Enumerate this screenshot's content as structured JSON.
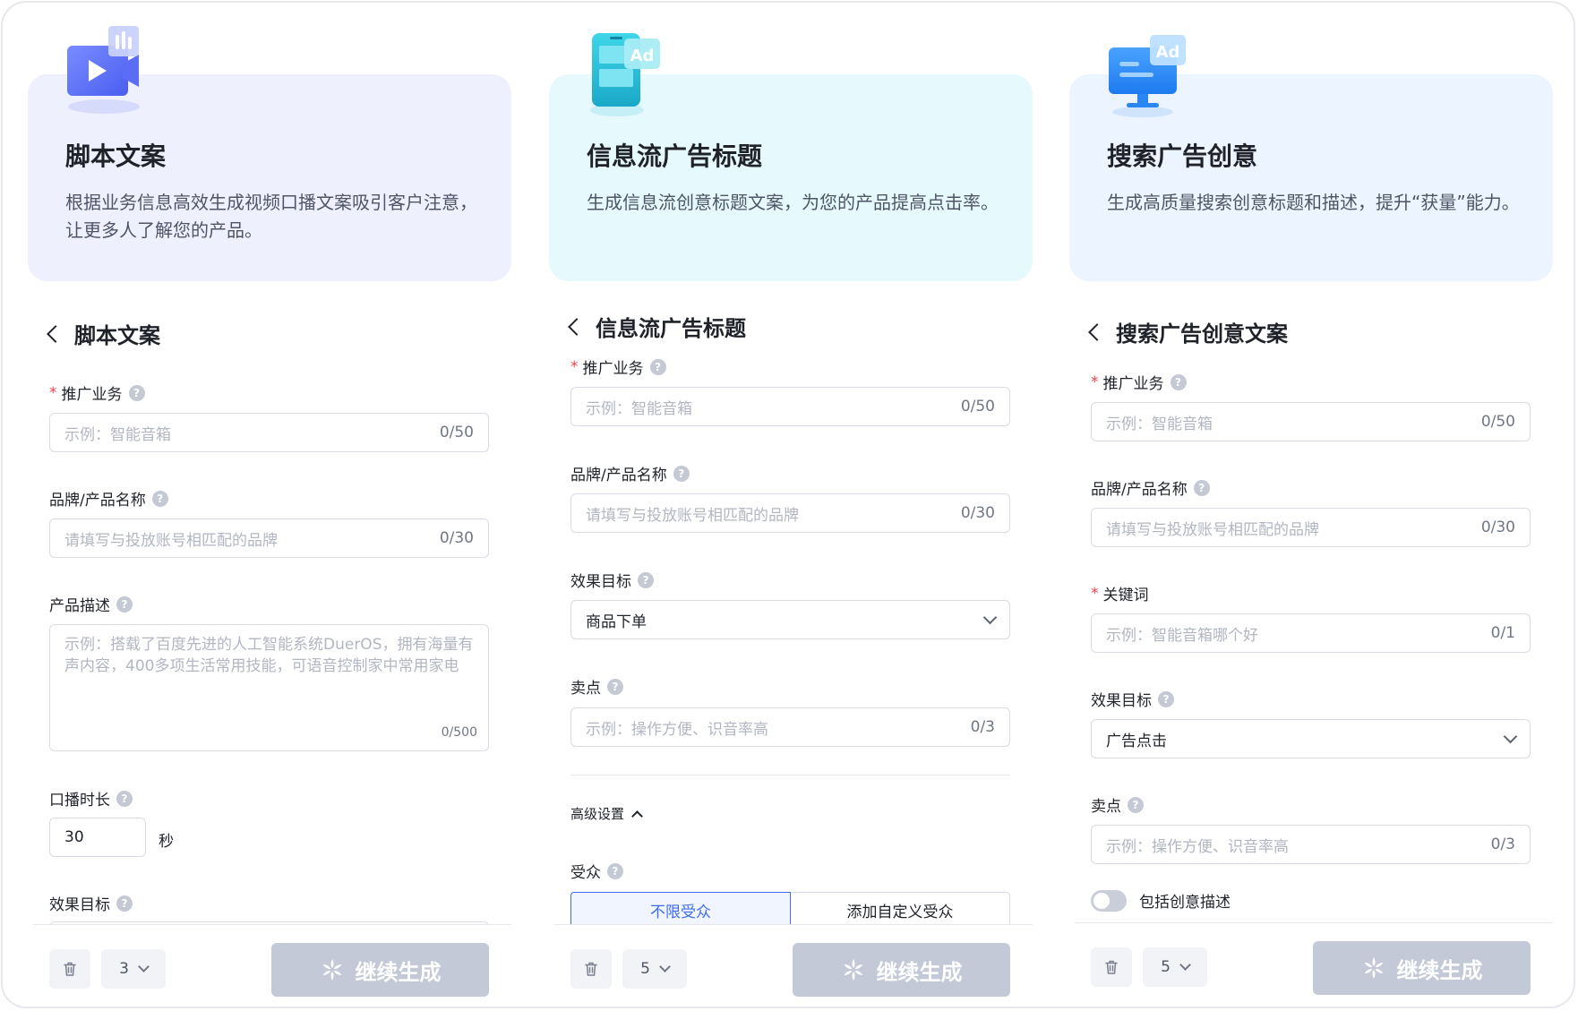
{
  "columns": [
    {
      "card": {
        "title": "脚本文案",
        "description": "根据业务信息高效生成视频口播文案吸引客户注意，让更多人了解您的产品。"
      },
      "form": {
        "back_title": "脚本文案",
        "promo_label": "推广业务",
        "promo_placeholder": "示例：智能音箱",
        "promo_count": "0/50",
        "brand_label": "品牌/产品名称",
        "brand_placeholder": "请填写与投放账号相匹配的品牌",
        "brand_count": "0/30",
        "desc_label": "产品描述",
        "desc_placeholder": "示例：搭载了百度先进的人工智能系统DuerOS，拥有海量有声内容，400多项生活常用技能，可语音控制家中常用家电",
        "desc_count": "0/500",
        "duration_label": "口播时长",
        "duration_value": "30",
        "duration_unit": "秒",
        "goal_label": "效果目标"
      },
      "footer": {
        "count": "3",
        "generate_label": "继续生成"
      }
    },
    {
      "card": {
        "title": "信息流广告标题",
        "description": "生成信息流创意标题文案，为您的产品提高点击率。"
      },
      "form": {
        "back_title": "信息流广告标题",
        "promo_label": "推广业务",
        "promo_placeholder": "示例：智能音箱",
        "promo_count": "0/50",
        "brand_label": "品牌/产品名称",
        "brand_placeholder": "请填写与投放账号相匹配的品牌",
        "brand_count": "0/30",
        "goal_label": "效果目标",
        "goal_value": "商品下单",
        "selling_label": "卖点",
        "selling_placeholder": "示例：操作方便、识音率高",
        "selling_count": "0/3",
        "advanced_label": "高级设置",
        "audience_label": "受众",
        "audience_options": [
          "不限受众",
          "添加自定义受众"
        ]
      },
      "footer": {
        "count": "5",
        "generate_label": "继续生成"
      }
    },
    {
      "card": {
        "title": "搜索广告创意",
        "description": "生成高质量搜索创意标题和描述，提升“获量”能力。"
      },
      "form": {
        "back_title": "搜索广告创意文案",
        "promo_label": "推广业务",
        "promo_placeholder": "示例：智能音箱",
        "promo_count": "0/50",
        "brand_label": "品牌/产品名称",
        "brand_placeholder": "请填写与投放账号相匹配的品牌",
        "brand_count": "0/30",
        "keyword_label": "关键词",
        "keyword_placeholder": "示例：智能音箱哪个好",
        "keyword_count": "0/1",
        "goal_label": "效果目标",
        "goal_value": "广告点击",
        "selling_label": "卖点",
        "selling_placeholder": "示例：操作方便、识音率高",
        "selling_count": "0/3",
        "toggle_label": "包括创意描述"
      },
      "footer": {
        "count": "5",
        "generate_label": "继续生成"
      }
    }
  ],
  "colors": {
    "required": "#f2434a",
    "primary": "#3e6cf0",
    "button_disabled": "#c3c9d6"
  },
  "icons": [
    "video-ad-icon",
    "phone-ad-icon",
    "monitor-ad-icon",
    "help-icon",
    "back-chevron-icon",
    "dropdown-caret-icon",
    "trash-icon",
    "sparkle-icon"
  ]
}
